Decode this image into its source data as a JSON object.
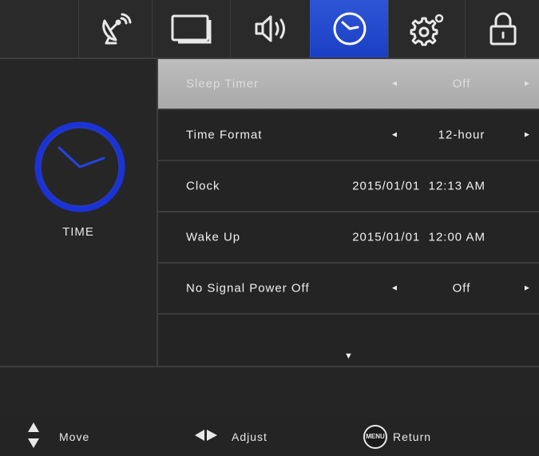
{
  "tabs": [
    {
      "name": "channel",
      "icon": "satellite-dish-icon",
      "active": false
    },
    {
      "name": "picture",
      "icon": "screen-icon",
      "active": false
    },
    {
      "name": "sound",
      "icon": "speaker-icon",
      "active": false
    },
    {
      "name": "time",
      "icon": "clock-icon",
      "active": true
    },
    {
      "name": "setup",
      "icon": "gear-icon",
      "active": false
    },
    {
      "name": "lock",
      "icon": "padlock-icon",
      "active": false
    }
  ],
  "section": {
    "title": "TIME",
    "icon": "clock-icon"
  },
  "menu": {
    "items": [
      {
        "label": "Sleep Timer",
        "value": "Off",
        "adjustable": true,
        "selected": true
      },
      {
        "label": "Time Format",
        "value": "12-hour",
        "adjustable": true,
        "selected": false
      },
      {
        "label": "Clock",
        "value": "2015/01/01  12:13 AM",
        "adjustable": false,
        "selected": false
      },
      {
        "label": "Wake Up",
        "value": "2015/01/01  12:00 AM",
        "adjustable": false,
        "selected": false
      },
      {
        "label": "No Signal Power Off",
        "value": "Off",
        "adjustable": true,
        "selected": false
      }
    ],
    "arrows": {
      "left": "◄",
      "right": "►",
      "down": "▼"
    }
  },
  "footer": {
    "move_label": "Move",
    "adjust_label": "Adjust",
    "menu_badge": "MENU",
    "return_label": "Return"
  },
  "colors": {
    "accent": "#1f45cc",
    "selected_row": "#b3b3b3",
    "background": "#242424"
  }
}
